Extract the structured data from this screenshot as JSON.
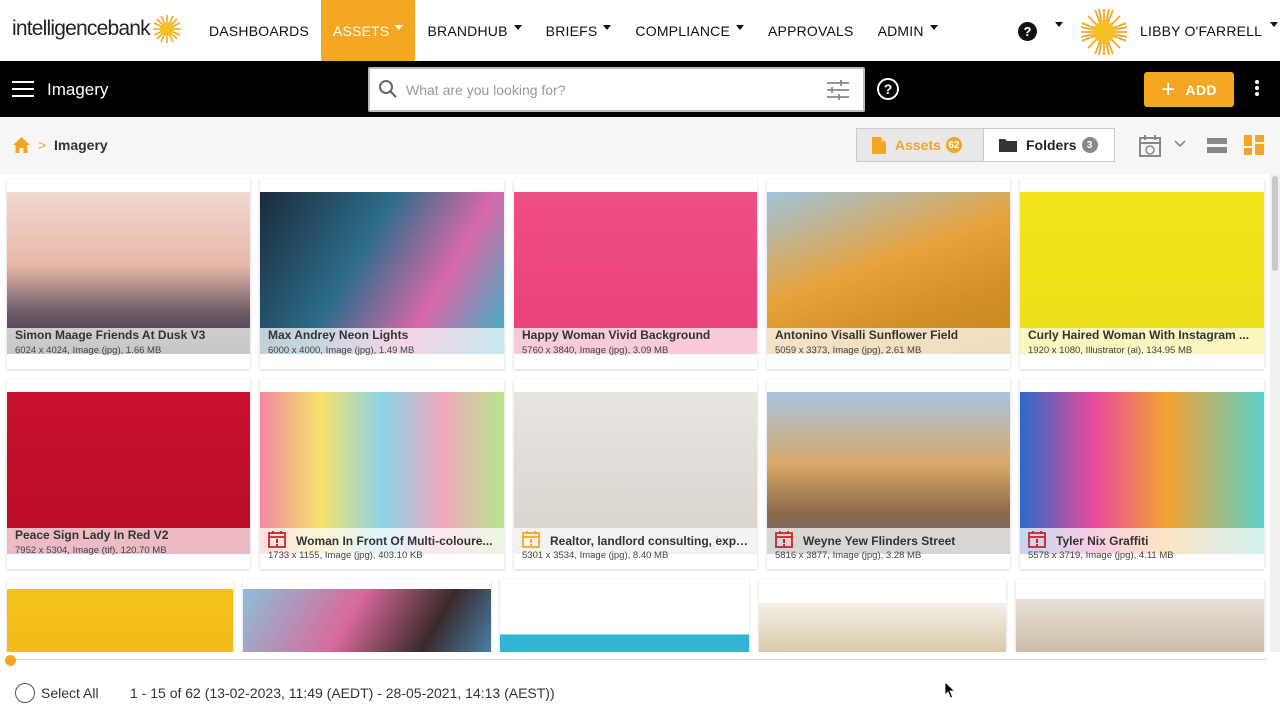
{
  "brand": {
    "logo_text": "intelligencebank",
    "accent": "#f5a623"
  },
  "topnav": {
    "items": [
      {
        "label": "DASHBOARDS",
        "caret": false
      },
      {
        "label": "ASSETS",
        "caret": true
      },
      {
        "label": "BRANDHUB",
        "caret": true
      },
      {
        "label": "BRIEFS",
        "caret": true
      },
      {
        "label": "COMPLIANCE",
        "caret": true
      },
      {
        "label": "APPROVALS",
        "caret": false
      },
      {
        "label": "ADMIN",
        "caret": true
      }
    ],
    "active": "ASSETS",
    "help_label": "?",
    "user_name": "LIBBY O'FARRELL"
  },
  "toolbar": {
    "section_title": "Imagery",
    "search_placeholder": "What are you looking for?",
    "help_label": "?",
    "add_label": "ADD",
    "add_plus": "+"
  },
  "breadcrumb": {
    "separator": ">",
    "current": "Imagery"
  },
  "view_toggle": {
    "assets_label": "Assets",
    "assets_count": "62",
    "folders_label": "Folders",
    "folders_count": "3"
  },
  "assets": [
    {
      "title": "Simon Maage Friends At Dusk V3",
      "meta": "6024 x 4024, Image (jpg), 1.66 MB",
      "warn": false,
      "warn_color": ""
    },
    {
      "title": "Max Andrey Neon Lights",
      "meta": "6000 x 4000, Image (jpg), 1.49 MB",
      "warn": false,
      "warn_color": ""
    },
    {
      "title": "Happy Woman Vivid Background",
      "meta": "5760 x 3840, Image (jpg), 3.09 MB",
      "warn": false,
      "warn_color": ""
    },
    {
      "title": "Antonino Visalli Sunflower Field",
      "meta": "5059 x 3373, Image (jpg), 2.61 MB",
      "warn": false,
      "warn_color": ""
    },
    {
      "title": "Curly Haired Woman With Instagram ...",
      "meta": "1920 x 1080, Illustrator (ai), 134.95 MB",
      "warn": false,
      "warn_color": ""
    },
    {
      "title": "Peace Sign Lady In Red V2",
      "meta": "7952 x 5304, Image (tif), 120.70 MB",
      "warn": false,
      "warn_color": ""
    },
    {
      "title": "Woman In Front Of Multi-coloure...",
      "meta": "1733 x 1155, Image (jpg), 403.10 KB",
      "warn": true,
      "warn_color": "#c62828"
    },
    {
      "title": "Realtor, landlord consulting, expl...",
      "meta": "5301 x 3534, Image (jpg), 8.40 MB",
      "warn": true,
      "warn_color": "#f5a623"
    },
    {
      "title": "Weyne Yew Flinders Street",
      "meta": "5816 x 3877, Image (jpg), 3.28 MB",
      "warn": true,
      "warn_color": "#c62828"
    },
    {
      "title": "Tyler Nix Graffiti",
      "meta": "5578 x 3719, Image (jpg), 4.11 MB",
      "warn": true,
      "warn_color": "#c62828"
    }
  ],
  "footer": {
    "select_all_label": "Select All",
    "range_text": "1 - 15 of 62 (13-02-2023, 11:49 (AEDT) - 28-05-2021, 14:13 (AEST))"
  }
}
